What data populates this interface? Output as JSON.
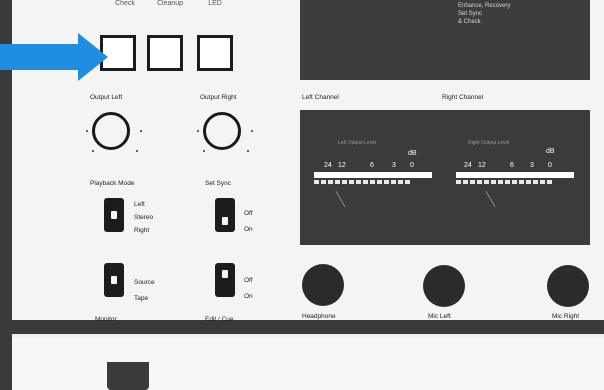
{
  "top_buttons": {
    "b1_label": "Check",
    "b2_label": "Cleanup",
    "b3_label": "LED"
  },
  "display": {
    "line1": "Enhance, Recovery",
    "line2": "Set Sync",
    "line3": "& Check"
  },
  "knobs": {
    "left_label": "Output Left",
    "right_label": "Output Right"
  },
  "meters": {
    "left_channel_label": "Left Channel",
    "right_channel_label": "Right Channel",
    "left_sublabel": "Left Output Level",
    "right_sublabel": "Right Output Level",
    "scale": [
      "24",
      "12",
      "6",
      "3",
      "0"
    ],
    "db_label": "dB",
    "colors": {
      "bar": "#ffffff",
      "segments": "#e8e8e8"
    }
  },
  "playback_mode": {
    "title": "Playback Mode",
    "options": [
      "Left",
      "Stereo",
      "Right"
    ]
  },
  "set_sync": {
    "title": "Set Sync",
    "options": [
      "Off",
      "On"
    ]
  },
  "monitor": {
    "title": "Monitor",
    "options": [
      "Source",
      "Tape"
    ]
  },
  "edit_cue": {
    "title": "Edit / Cue",
    "options": [
      "Off",
      "On"
    ]
  },
  "jacks": {
    "headphone": "Headphone",
    "mic_left": "Mic Left",
    "mic_right": "Mic Right"
  },
  "annotation": {
    "arrow_color": "#1f8de0",
    "arrow_icon": "right-arrow-icon"
  }
}
